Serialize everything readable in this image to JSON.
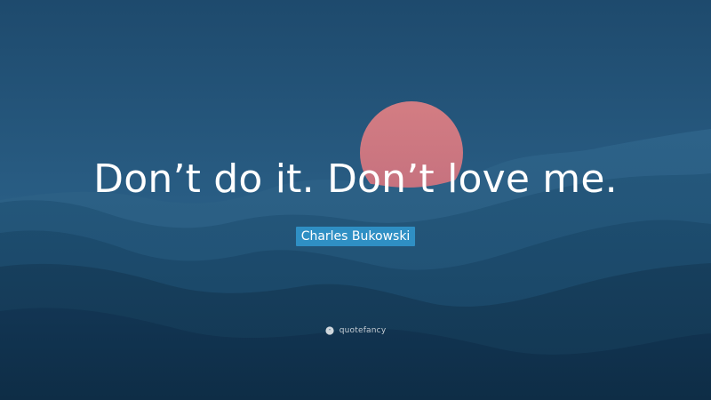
{
  "quote": {
    "text": "Don’t do it. Don’t love me."
  },
  "author": {
    "name": "Charles Bukowski"
  },
  "brand": {
    "name": "quotefancy",
    "icon": "quotefancy-logo-icon"
  },
  "colors": {
    "sky_top": "#1d4a6e",
    "sky_mid": "#2b6187",
    "sun": "#cf7a82",
    "author_badge": "#2f8fc4",
    "text": "#ffffff"
  }
}
